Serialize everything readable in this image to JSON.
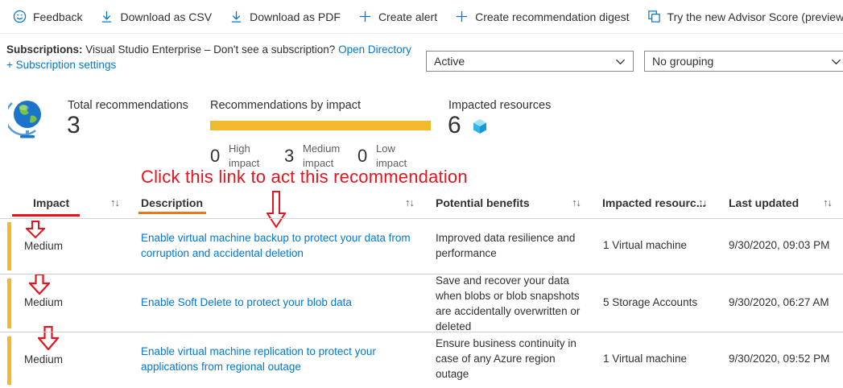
{
  "toolbar": {
    "feedback": "Feedback",
    "download_csv": "Download as CSV",
    "download_pdf": "Download as PDF",
    "create_alert": "Create alert",
    "create_digest": "Create recommendation digest",
    "advisor_score": "Try the new Advisor Score (preview)"
  },
  "subscriptions": {
    "label": "Subscriptions:",
    "value": "Visual Studio Enterprise – Don't see a subscription?",
    "open_directory": "Open Directory",
    "settings_link": "+ Subscription settings"
  },
  "filters": {
    "status": "Active",
    "grouping": "No grouping"
  },
  "summary": {
    "total_label": "Total recommendations",
    "total_value": "3",
    "by_impact_label": "Recommendations by impact",
    "high_count": "0",
    "high_label_1": "High",
    "high_label_2": "impact",
    "medium_count": "3",
    "medium_label_1": "Medium",
    "medium_label_2": "impact",
    "low_count": "0",
    "low_label_1": "Low",
    "low_label_2": "impact",
    "impacted_label": "Impacted resources",
    "impacted_value": "6"
  },
  "annotation": "Click this link to act this recommendation",
  "table": {
    "headers": {
      "impact": "Impact",
      "description": "Description",
      "benefits": "Potential benefits",
      "resources": "Impacted resourc...",
      "updated": "Last updated"
    },
    "sort_glyph": "↑↓",
    "rows": [
      {
        "impact": "Medium",
        "description_1": "Enable virtual machine backup to protect your data from",
        "description_2": "corruption and accidental deletion",
        "benefits_1": "Improved data resilience and",
        "benefits_2": "performance",
        "resources": "1 Virtual machine",
        "updated": "9/30/2020, 09:03 PM"
      },
      {
        "impact": "Medium",
        "description_1": "Enable Soft Delete to protect your blob data",
        "benefits_1": "Save and recover your data",
        "benefits_2": "when blobs or blob snapshots",
        "benefits_3": "are accidentally overwritten or",
        "benefits_4": "deleted",
        "resources": "5 Storage Accounts",
        "updated": "9/30/2020, 06:27 AM"
      },
      {
        "impact": "Medium",
        "description_1": "Enable virtual machine replication to protect your",
        "description_2": "applications from regional outage",
        "benefits_1": "Ensure business continuity in",
        "benefits_2": "case of any Azure region",
        "benefits_3": "outage",
        "resources": "1 Virtual machine",
        "updated": "9/30/2020, 09:52 PM"
      }
    ]
  },
  "colors": {
    "accent": "#0078d4",
    "medium_impact": "#f2b92c",
    "annotation_red": "#e8131c",
    "annotation_orange": "#e87722"
  },
  "icons": [
    "smile-icon",
    "download-icon",
    "plus-icon",
    "copy-icon",
    "chevron-down-icon",
    "globe-icon",
    "cube-icon",
    "red-arrow-down-icon"
  ]
}
